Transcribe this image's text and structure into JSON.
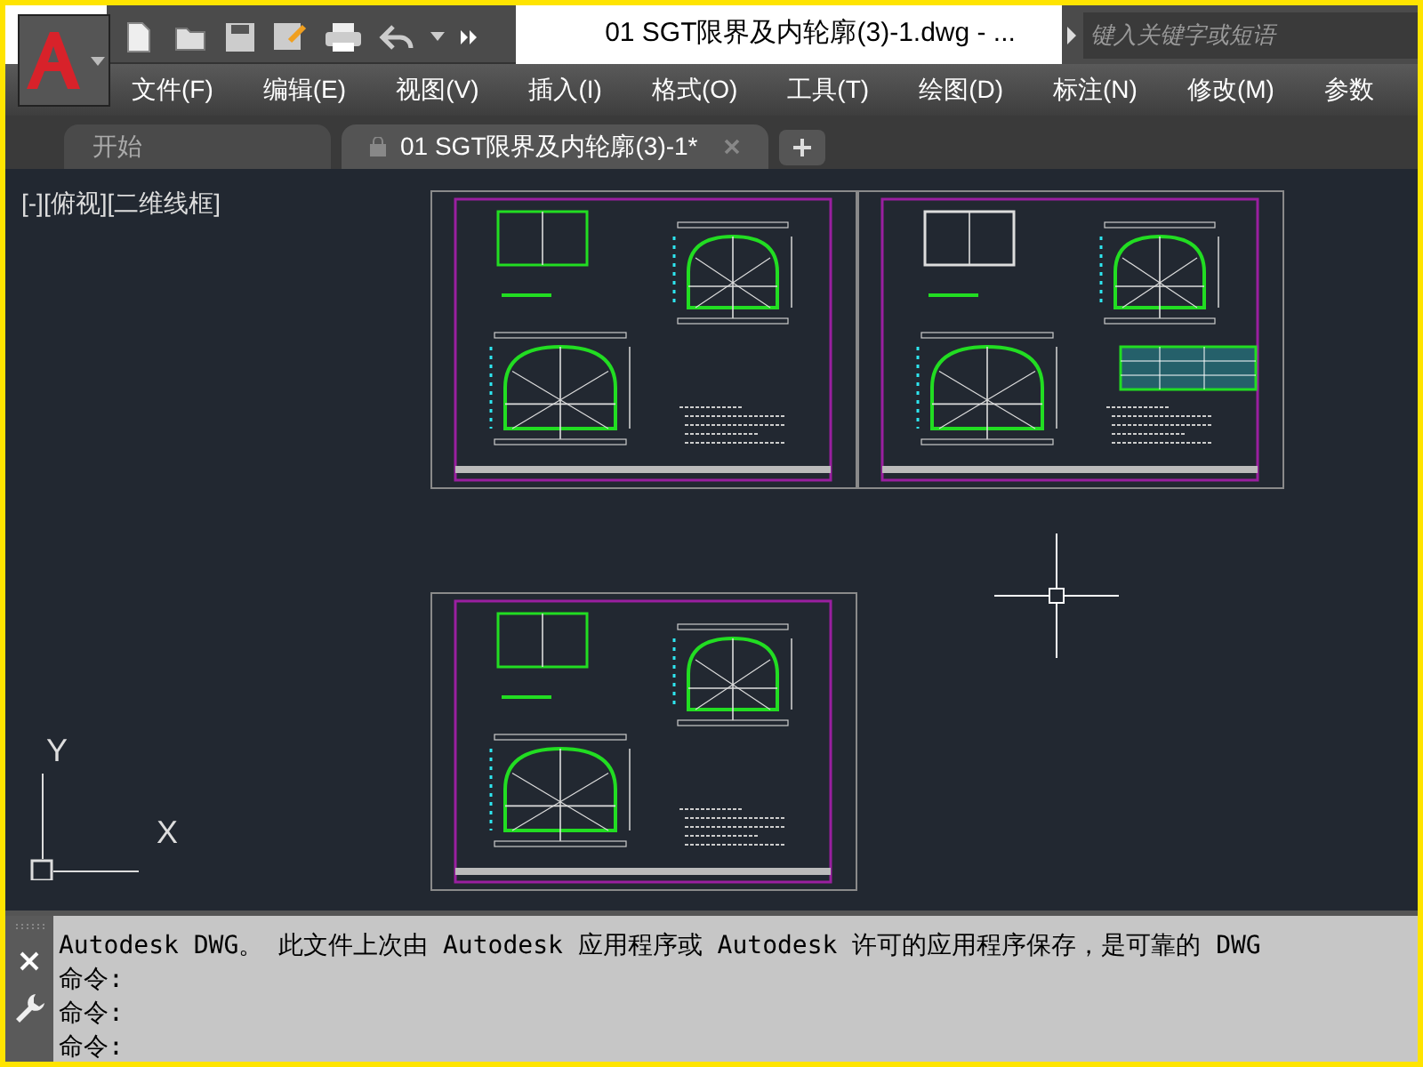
{
  "title": "01 SGT限界及内轮廓(3)-1.dwg - ...",
  "search": {
    "placeholder": "键入关键字或短语"
  },
  "menu": [
    "文件(F)",
    "编辑(E)",
    "视图(V)",
    "插入(I)",
    "格式(O)",
    "工具(T)",
    "绘图(D)",
    "标注(N)",
    "修改(M)",
    "参数"
  ],
  "tabs": [
    {
      "label": "开始",
      "selected": false
    },
    {
      "label": "01 SGT限界及内轮廓(3)-1*",
      "selected": true
    }
  ],
  "viewport_label": "[-][俯视][二维线框]",
  "ucs": {
    "y_label": "Y",
    "x_label": "X"
  },
  "sheets": [
    {
      "table": false
    },
    {
      "table": true
    },
    {
      "table": false
    }
  ],
  "command_history": [
    "Autodesk DWG。  此文件上次由 Autodesk 应用程序或 Autodesk 许可的应用程序保存，是可靠的 DWG",
    "命令:",
    "命令:",
    "命令:"
  ]
}
